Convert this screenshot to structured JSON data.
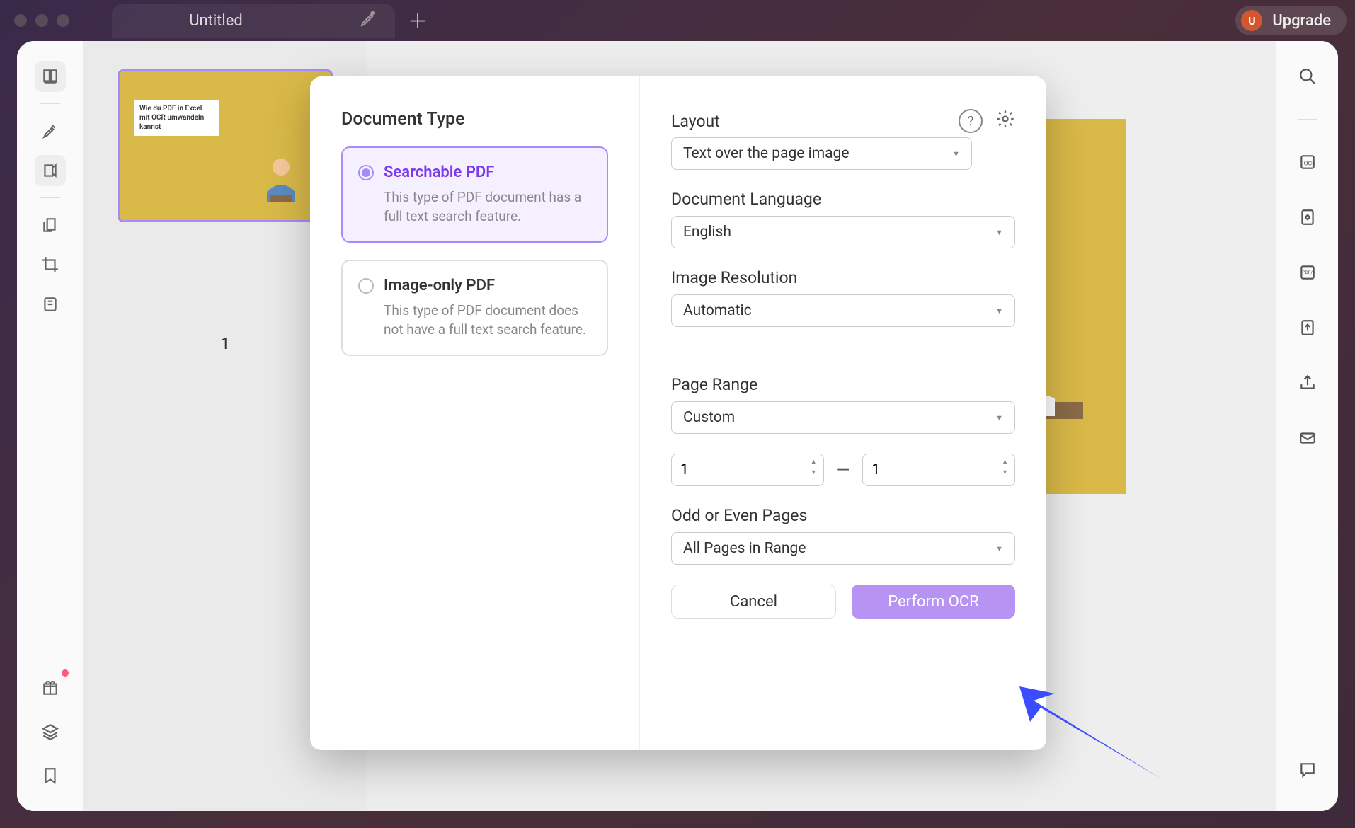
{
  "window": {
    "tab_title": "Untitled",
    "upgrade_label": "Upgrade",
    "avatar_letter": "U"
  },
  "thumbnail": {
    "page_number": "1",
    "caption": "Wie du PDF in Excel mit OCR umwandeln kannst"
  },
  "modal": {
    "left": {
      "heading": "Document Type",
      "options": [
        {
          "title": "Searchable PDF",
          "desc": "This type of PDF document has a full text search feature.",
          "selected": true
        },
        {
          "title": "Image-only PDF",
          "desc": "This type of PDF document does not have a full text search feature.",
          "selected": false
        }
      ]
    },
    "right": {
      "layout_label": "Layout",
      "layout_value": "Text over the page image",
      "language_label": "Document Language",
      "language_value": "English",
      "resolution_label": "Image Resolution",
      "resolution_value": "Automatic",
      "page_range_label": "Page Range",
      "page_range_value": "Custom",
      "range_from": "1",
      "range_to": "1",
      "odd_even_label": "Odd or Even Pages",
      "odd_even_value": "All Pages in Range",
      "cancel_label": "Cancel",
      "confirm_label": "Perform OCR"
    }
  }
}
